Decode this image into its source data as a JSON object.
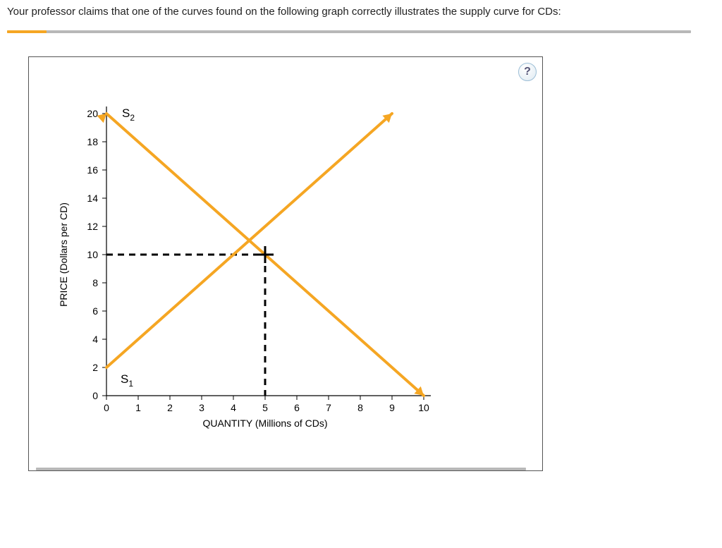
{
  "question_text": "Your professor claims that one of the curves found on the following graph correctly illustrates the supply curve for CDs:",
  "help_label": "?",
  "chart_data": {
    "type": "line",
    "xlabel": "QUANTITY (Millions of CDs)",
    "ylabel": "PRICE (Dollars per CD)",
    "xlim": [
      0,
      10
    ],
    "ylim": [
      0,
      20
    ],
    "x_ticks": [
      0,
      1,
      2,
      3,
      4,
      5,
      6,
      7,
      8,
      9,
      10
    ],
    "y_ticks": [
      0,
      2,
      4,
      6,
      8,
      10,
      12,
      14,
      16,
      18,
      20
    ],
    "grid": false,
    "series": [
      {
        "name": "S1",
        "label_sub": "1",
        "label_base": "S",
        "x": [
          0,
          10
        ],
        "y": [
          2,
          22
        ],
        "note": "upward-sloping orange line, labeled near origin"
      },
      {
        "name": "S2",
        "label_sub": "2",
        "label_base": "S",
        "x": [
          0,
          10
        ],
        "y": [
          20,
          0
        ],
        "note": "downward-sloping orange line, labeled near top-left"
      }
    ],
    "intersection_marker": {
      "x": 5,
      "y": 10
    },
    "line_color": "#F5A623"
  }
}
